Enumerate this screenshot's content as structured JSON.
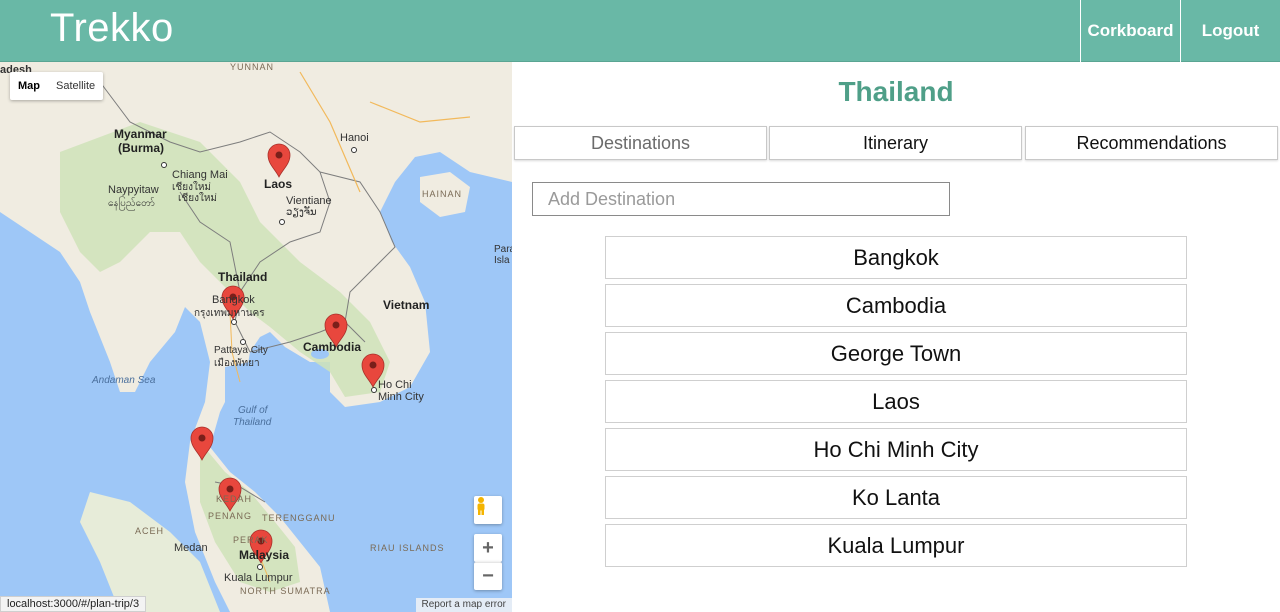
{
  "header": {
    "brand": "Trekko",
    "nav": {
      "corkboard": "Corkboard",
      "logout": "Logout"
    }
  },
  "map": {
    "type_buttons": {
      "map": "Map",
      "satellite": "Satellite"
    },
    "labels": {
      "yunnan": "YUNNAN",
      "hanoi": "Hanoi",
      "myanmar": "Myanmar",
      "burma": "(Burma)",
      "chiang_mai": "Chiang Mai",
      "chiang_mai_thai": "เชียงใหม่",
      "chiang_mai_thai_2": "เชียงใหม่",
      "naypyitaw": "Naypyitaw",
      "naypyitaw_local": "နေပြည်တော်",
      "laos": "Laos",
      "vientiane": "Vientiane",
      "vientiane_local": "ວຽງຈັນ",
      "hainan": "HAINAN",
      "thailand": "Thailand",
      "bangkok": "Bangkok",
      "bangkok_thai": "กรุงเทพมหานคร",
      "pattaya": "Pattaya City",
      "pattaya_thai": "เมืองพัทยา",
      "cambodia": "Cambodia",
      "vietnam": "Vietnam",
      "andaman": "Andaman Sea",
      "ho_chi_minh": "Ho Chi",
      "ho_chi_minh_2": "Minh City",
      "gulf": "Gulf of",
      "gulf_2": "Thailand",
      "kedah": "KEDAH",
      "penang": "PENANG",
      "terengganu": "TERENGGANU",
      "aceh": "ACEH",
      "medan": "Medan",
      "perak": "PERAK",
      "malaysia": "Malaysia",
      "kuala_lumpur": "Kuala Lumpur",
      "riau": "RIAU ISLANDS",
      "north_sumatra": "NORTH SUMATRA",
      "bangladesh": "adesh",
      "paracel": "Para",
      "paracel_2": "Isla"
    },
    "status_url": "localhost:3000/#/plan-trip/3",
    "report": "Report a map error",
    "google": "Google"
  },
  "panel": {
    "title": "Thailand",
    "tabs": {
      "destinations": "Destinations",
      "itinerary": "Itinerary",
      "recommendations": "Recommendations"
    },
    "add_placeholder": "Add Destination",
    "destinations": [
      "Bangkok",
      "Cambodia",
      "George Town",
      "Laos",
      "Ho Chi Minh City",
      "Ko Lanta",
      "Kuala Lumpur"
    ]
  },
  "colors": {
    "header": "#69b8a6",
    "title": "#4f9f88",
    "marker": "#e8473d",
    "water": "#9ec7f7",
    "land": "#f0ece1",
    "forest": "#cfe3b9"
  }
}
